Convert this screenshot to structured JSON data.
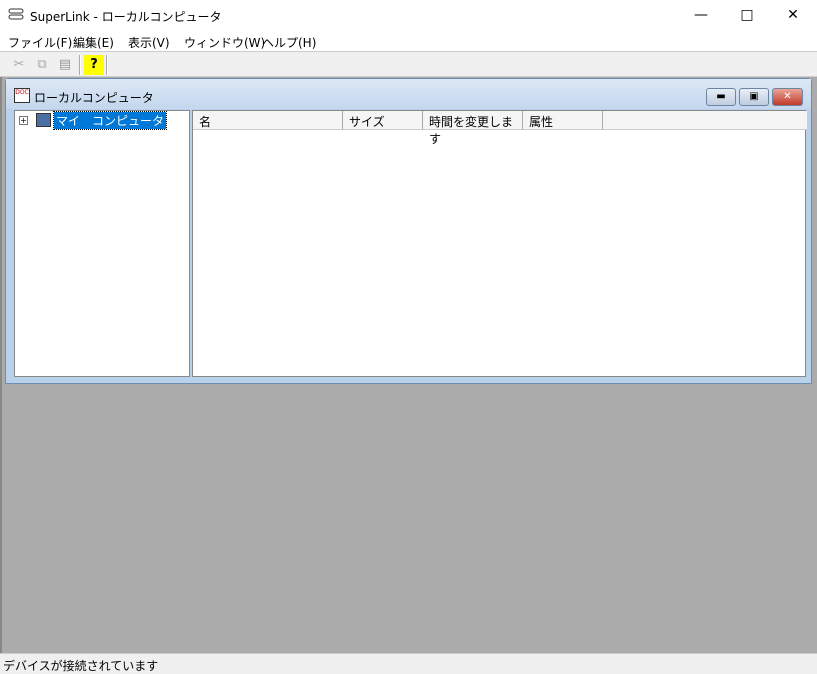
{
  "window": {
    "title": "SuperLink - ローカルコンピュータ"
  },
  "menu": [
    "ファイル(F)",
    "編集(E)",
    "表示(V)",
    "ウィンドウ(W)",
    "ヘルプ(H)"
  ],
  "child": {
    "title": "ローカルコンピュータ",
    "tree_root": "マイ　コンピュータ"
  },
  "columns": [
    "名",
    "サイズ",
    "時間を変更します",
    "属性"
  ],
  "status": "デバイスが接続されています"
}
